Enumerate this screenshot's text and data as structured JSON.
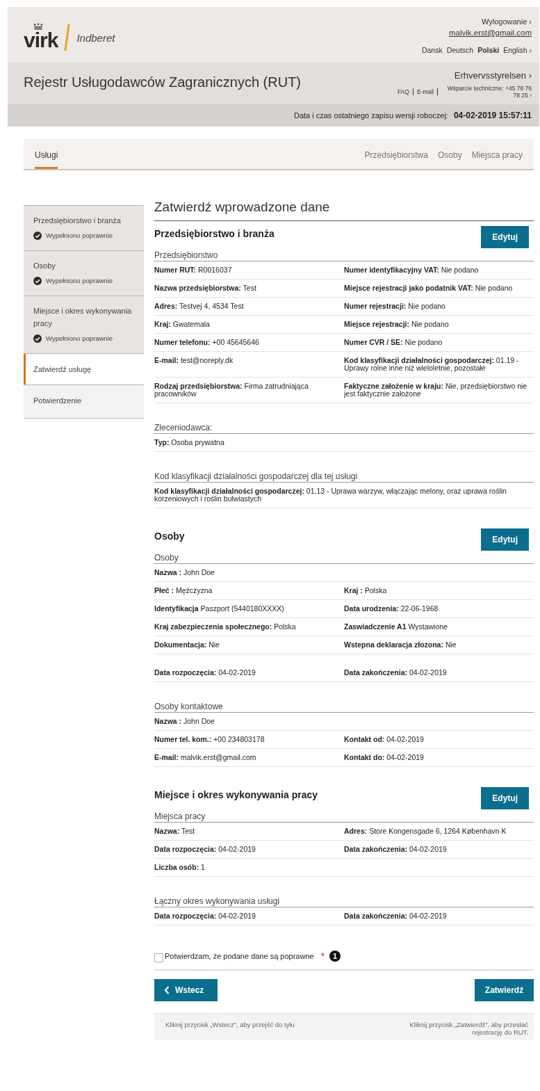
{
  "header": {
    "logo": "virk",
    "product": "Indberet",
    "logout": "Wylogowanie ›",
    "user_email": "malvik.erst@gmail.com",
    "languages": [
      {
        "label": "Dansk",
        "selected": false
      },
      {
        "label": "Deutsch",
        "selected": false
      },
      {
        "label": "Polski",
        "selected": true
      },
      {
        "label": "English ›",
        "selected": false
      }
    ],
    "title": "Rejestr Usługodawców Zagranicznych (RUT)",
    "agency": "Erhvervsstyrelsen ›",
    "links": [
      "FAQ",
      "E-mail",
      "Wsparcie techniczne: +45 78 76 78 25 ›"
    ],
    "draft_label": "Data i czas ostatniego zapisu wersji roboczej:",
    "draft_time": "04-02-2019 15:57:11"
  },
  "tabs": [
    {
      "label": "Usługi",
      "selected": true
    },
    {
      "label": "Przedsiębiorstwa",
      "selected": false
    },
    {
      "label": "Osoby",
      "selected": false
    },
    {
      "label": "Miejsca pracy",
      "selected": false
    }
  ],
  "sidebar": {
    "items": [
      {
        "label": "Przedsiębiorstwo i branża",
        "status": "Wypełniono poprawnie",
        "kind": "completed",
        "selected": false
      },
      {
        "label": "Osoby",
        "status": "Wypełniono poprawnie",
        "kind": "completed",
        "selected": false
      },
      {
        "label": "Miejsce i okres wykonywania pracy",
        "status": "Wypełniono poprawnie",
        "kind": "completed",
        "selected": false
      },
      {
        "label": "Zatwierdź usługę",
        "kind": "current",
        "selected": true
      },
      {
        "label": "Potwierdzenie",
        "kind": "upcoming",
        "selected": false
      }
    ]
  },
  "page_title": "Zatwierdź wprowadzone dane",
  "sections": [
    {
      "title": "Przedsiębiorstwo i branża",
      "edit_button": "Edytuj",
      "groups": [
        {
          "label": "Przedsiębiorstwo",
          "rows": [
            [
              {
                "label": "Numer RUT:",
                "value": "R0016037"
              },
              {
                "label": "Numer identyfikacyjny VAT:",
                "value": "Nie podano"
              }
            ],
            [
              {
                "label": "Nazwa przedsiębiorstwa:",
                "value": "Test"
              },
              {
                "label": "Miejsce rejestracji jako podatnik VAT:",
                "value": "Nie podano"
              }
            ],
            [
              {
                "label": "Adres:",
                "value": "Testvej 4, 4534 Test"
              },
              {
                "label": "Numer rejestracji:",
                "value": "Nie podano"
              }
            ],
            [
              {
                "label": "Kraj:",
                "value": "Gwatemala"
              },
              {
                "label": "Miejsce rejestracji:",
                "value": "Nie podano"
              }
            ],
            [
              {
                "label": "Numer telefonu:",
                "value": "+00 45645646"
              },
              {
                "label": "Numer CVR / SE:",
                "value": "Nie podano"
              }
            ],
            [
              {
                "label": "E-mail:",
                "value": "test@noreply.dk"
              },
              {
                "label": "Kod klasyfikacji działalności gospodarczej:",
                "value": "01.19 - Uprawy rolne inne niż wieloletnie, pozostałe"
              }
            ],
            [
              {
                "label": "Rodzaj przedsiębiorstwa:",
                "value": "Firma zatrudniająca pracowników"
              },
              {
                "label": "Faktyczne założenie w kraju:",
                "value": "Nie, przedsiębiorstwo nie jest faktycznie założone"
              }
            ]
          ]
        },
        {
          "label": "Zleceniodawca:",
          "rows": [
            [
              {
                "label": "Typ:",
                "value": "Osoba prywatna"
              }
            ]
          ]
        },
        {
          "label": "Kod klasyfikacji działalności gospodarczej dla tej usługi",
          "rows": [
            [
              {
                "label": "Kod klasyfikacji działalności gospodarczej:",
                "value": "01.13 - Uprawa warzyw, włączając melony, oraz uprawa roślin korzeniowych i roślin bulwiastych"
              }
            ]
          ]
        }
      ]
    },
    {
      "title": "Osoby",
      "edit_button": "Edytuj",
      "groups": [
        {
          "label": "Osoby",
          "rows": [
            [
              {
                "label": "Nazwa :",
                "value": "John Doe"
              }
            ],
            [
              {
                "label": "Płeć :",
                "value": "Mężczyzna"
              },
              {
                "label": "Kraj :",
                "value": "Polska"
              }
            ],
            [
              {
                "label": "Identyfikacja",
                "value": "Paszport (5440180XXXX)"
              },
              {
                "label": "Data urodzenia:",
                "value": "22-06-1968"
              }
            ],
            [
              {
                "label": "Kraj zabezpieczenia społecznego:",
                "value": "Polska"
              },
              {
                "label": "Zaswiadczenie A1",
                "value": "Wystawione"
              }
            ],
            [
              {
                "label": "Dokumentacja:",
                "value": "Nie"
              },
              {
                "label": "Wstepna deklaracja złozona:",
                "value": "Nie"
              }
            ]
          ]
        },
        {
          "rows": [
            [
              {
                "label": "Data rozpoczęcia:",
                "value": "04-02-2019"
              },
              {
                "label": "Data zakończenia:",
                "value": "04-02-2019"
              }
            ]
          ]
        },
        {
          "label": "Osoby kontaktowe",
          "rows": [
            [
              {
                "label": "Nazwa :",
                "value": "John Doe"
              }
            ],
            [
              {
                "label": "Numer tel. kom.:",
                "value": "+00 234803178"
              },
              {
                "label": "Kontakt od:",
                "value": "04-02-2019"
              }
            ],
            [
              {
                "label": "E-mail:",
                "value": "malvik.erst@gmail.com"
              },
              {
                "label": "Kontakt do:",
                "value": "04-02-2019"
              }
            ]
          ]
        }
      ]
    },
    {
      "title": "Miejsce i okres wykonywania pracy",
      "edit_button": "Edytuj",
      "groups": [
        {
          "label": "Miejsca pracy",
          "rows": [
            [
              {
                "label": "Nazwa:",
                "value": "Test"
              },
              {
                "label": "Adres:",
                "value": "Store Kongensgade 6, 1264 København K"
              }
            ],
            [
              {
                "label": "Data rozpoczęcia:",
                "value": "04-02-2019"
              },
              {
                "label": "Data zakończenia:",
                "value": "04-02-2019"
              }
            ],
            [
              {
                "label": "Liczba osób:",
                "value": "1"
              }
            ]
          ]
        },
        {
          "label": "Łączny okres wykonywania usługi",
          "rows": [
            [
              {
                "label": "Data rozpoczęcia:",
                "value": "04-02-2019"
              },
              {
                "label": "Data zakończenia:",
                "value": "04-02-2019"
              }
            ]
          ]
        }
      ]
    }
  ],
  "confirmation": {
    "label": "Potwierdzam, że podane dane są poprawne",
    "checked": false,
    "required_mark": "*",
    "marker": "1"
  },
  "buttons": {
    "back": "Wstecz",
    "submit": "Zatwierdź"
  },
  "hints": [
    "Kliknij przycisk „Wstecz”, aby przejść do tyłu",
    "Kliknij przycisk „Zatwierdź”, aby przesłać rejestrację do RUT."
  ]
}
